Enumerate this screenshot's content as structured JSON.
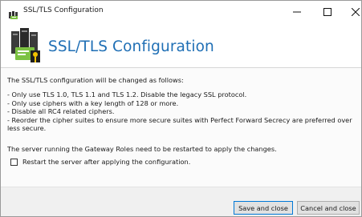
{
  "window": {
    "title": "SSL/TLS Configuration",
    "icon": "server-certificate-icon",
    "controls": {
      "minimize": "minimize-icon",
      "maximize": "maximize-icon",
      "close": "close-icon"
    }
  },
  "header": {
    "title": "SSL/TLS Configuration",
    "icon": "server-certificate-icon",
    "title_color": "#1f6fb5"
  },
  "content": {
    "intro": "The SSL/TLS configuration will be changed as follows:",
    "bullets": [
      "- Only use TLS 1.0, TLS 1.1 and TLS 1.2. Disable the legacy SSL protocol.",
      "- Only use ciphers with a key length of 128 or more.",
      "- Disable all RC4 related ciphers.",
      "- Reorder the cipher suites to ensure more secure suites with Perfect Forward Secrecy are preferred over less secure."
    ],
    "restart_note": "The server running the Gateway Roles need to be restarted to apply the changes.",
    "restart_checkbox": {
      "label": "Restart the server after applying the configuration.",
      "checked": false
    }
  },
  "footer": {
    "save_label": "Save and close",
    "cancel_label": "Cancel and close",
    "accent": "#0078d7"
  }
}
